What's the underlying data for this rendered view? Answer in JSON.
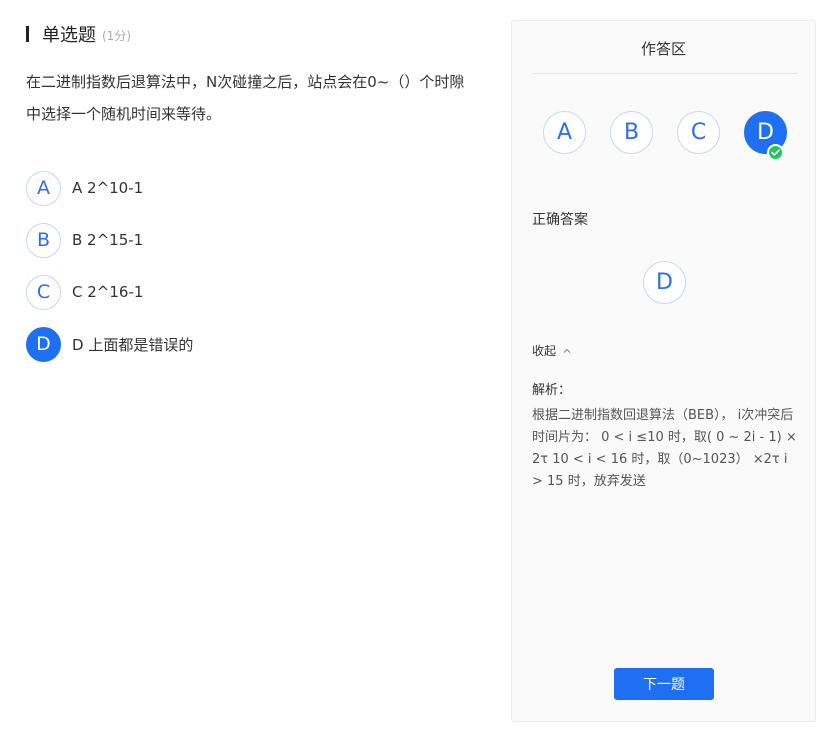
{
  "question": {
    "type": "单选题",
    "score": "(1分)",
    "stem": "在二进制指数后退算法中，N次碰撞之后，站点会在0~（）个时隙中选择一个随机时间来等待。",
    "options": [
      {
        "letter": "A",
        "text": "A 2^10-1",
        "selected": false
      },
      {
        "letter": "B",
        "text": "B 2^15-1",
        "selected": false
      },
      {
        "letter": "C",
        "text": "C 2^16-1",
        "selected": false
      },
      {
        "letter": "D",
        "text": "D 上面都是错误的",
        "selected": true
      }
    ]
  },
  "panel": {
    "title": "作答区",
    "choices": [
      "A",
      "B",
      "C",
      "D"
    ],
    "selected_choice": "D",
    "correct_label": "正确答案",
    "correct_answer": "D",
    "collapse_label": "收起",
    "analysis_label": "解析：",
    "analysis_text": "根据二进制指数回退算法（BEB）， i次冲突后时间片为：  0 < i ≤10 时，取( 0 ~ 2i - 1) ×2τ 10 < i < 16 时，取（0~1023） ×2τ i > 15 时，放弃发送",
    "next_button": "下一题"
  },
  "colors": {
    "primary": "#1f6ff2",
    "success": "#22c55e",
    "circle_border": "#c6d6f7"
  },
  "icons": {
    "check_badge": "check-circle-icon",
    "collapse": "chevron-up-icon"
  }
}
